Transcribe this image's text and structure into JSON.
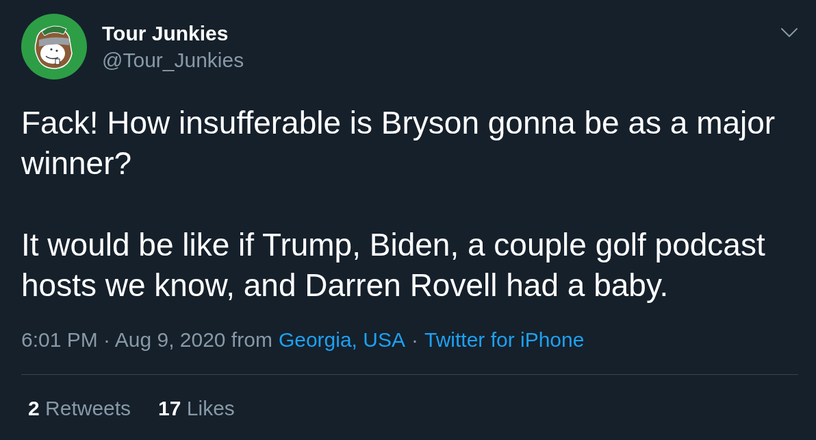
{
  "author": {
    "name": "Tour Junkies",
    "handle": "@Tour_Junkies"
  },
  "tweet": {
    "paragraphs": [
      "Fack! How insufferable is Bryson gonna be as a major winner?",
      "It would be like if Trump, Biden, a couple golf podcast hosts we know, and Darren Rovell had a baby."
    ]
  },
  "meta": [
    {
      "kind": "text",
      "text": "6:01 PM · Aug 9, 2020 from"
    },
    {
      "kind": "link",
      "text": "Georgia, USA"
    },
    {
      "kind": "text",
      "text": "·"
    },
    {
      "kind": "link",
      "text": "Twitter for iPhone"
    }
  ],
  "stats": [
    {
      "count": "2",
      "label": "Retweets"
    },
    {
      "count": "17",
      "label": "Likes"
    }
  ]
}
